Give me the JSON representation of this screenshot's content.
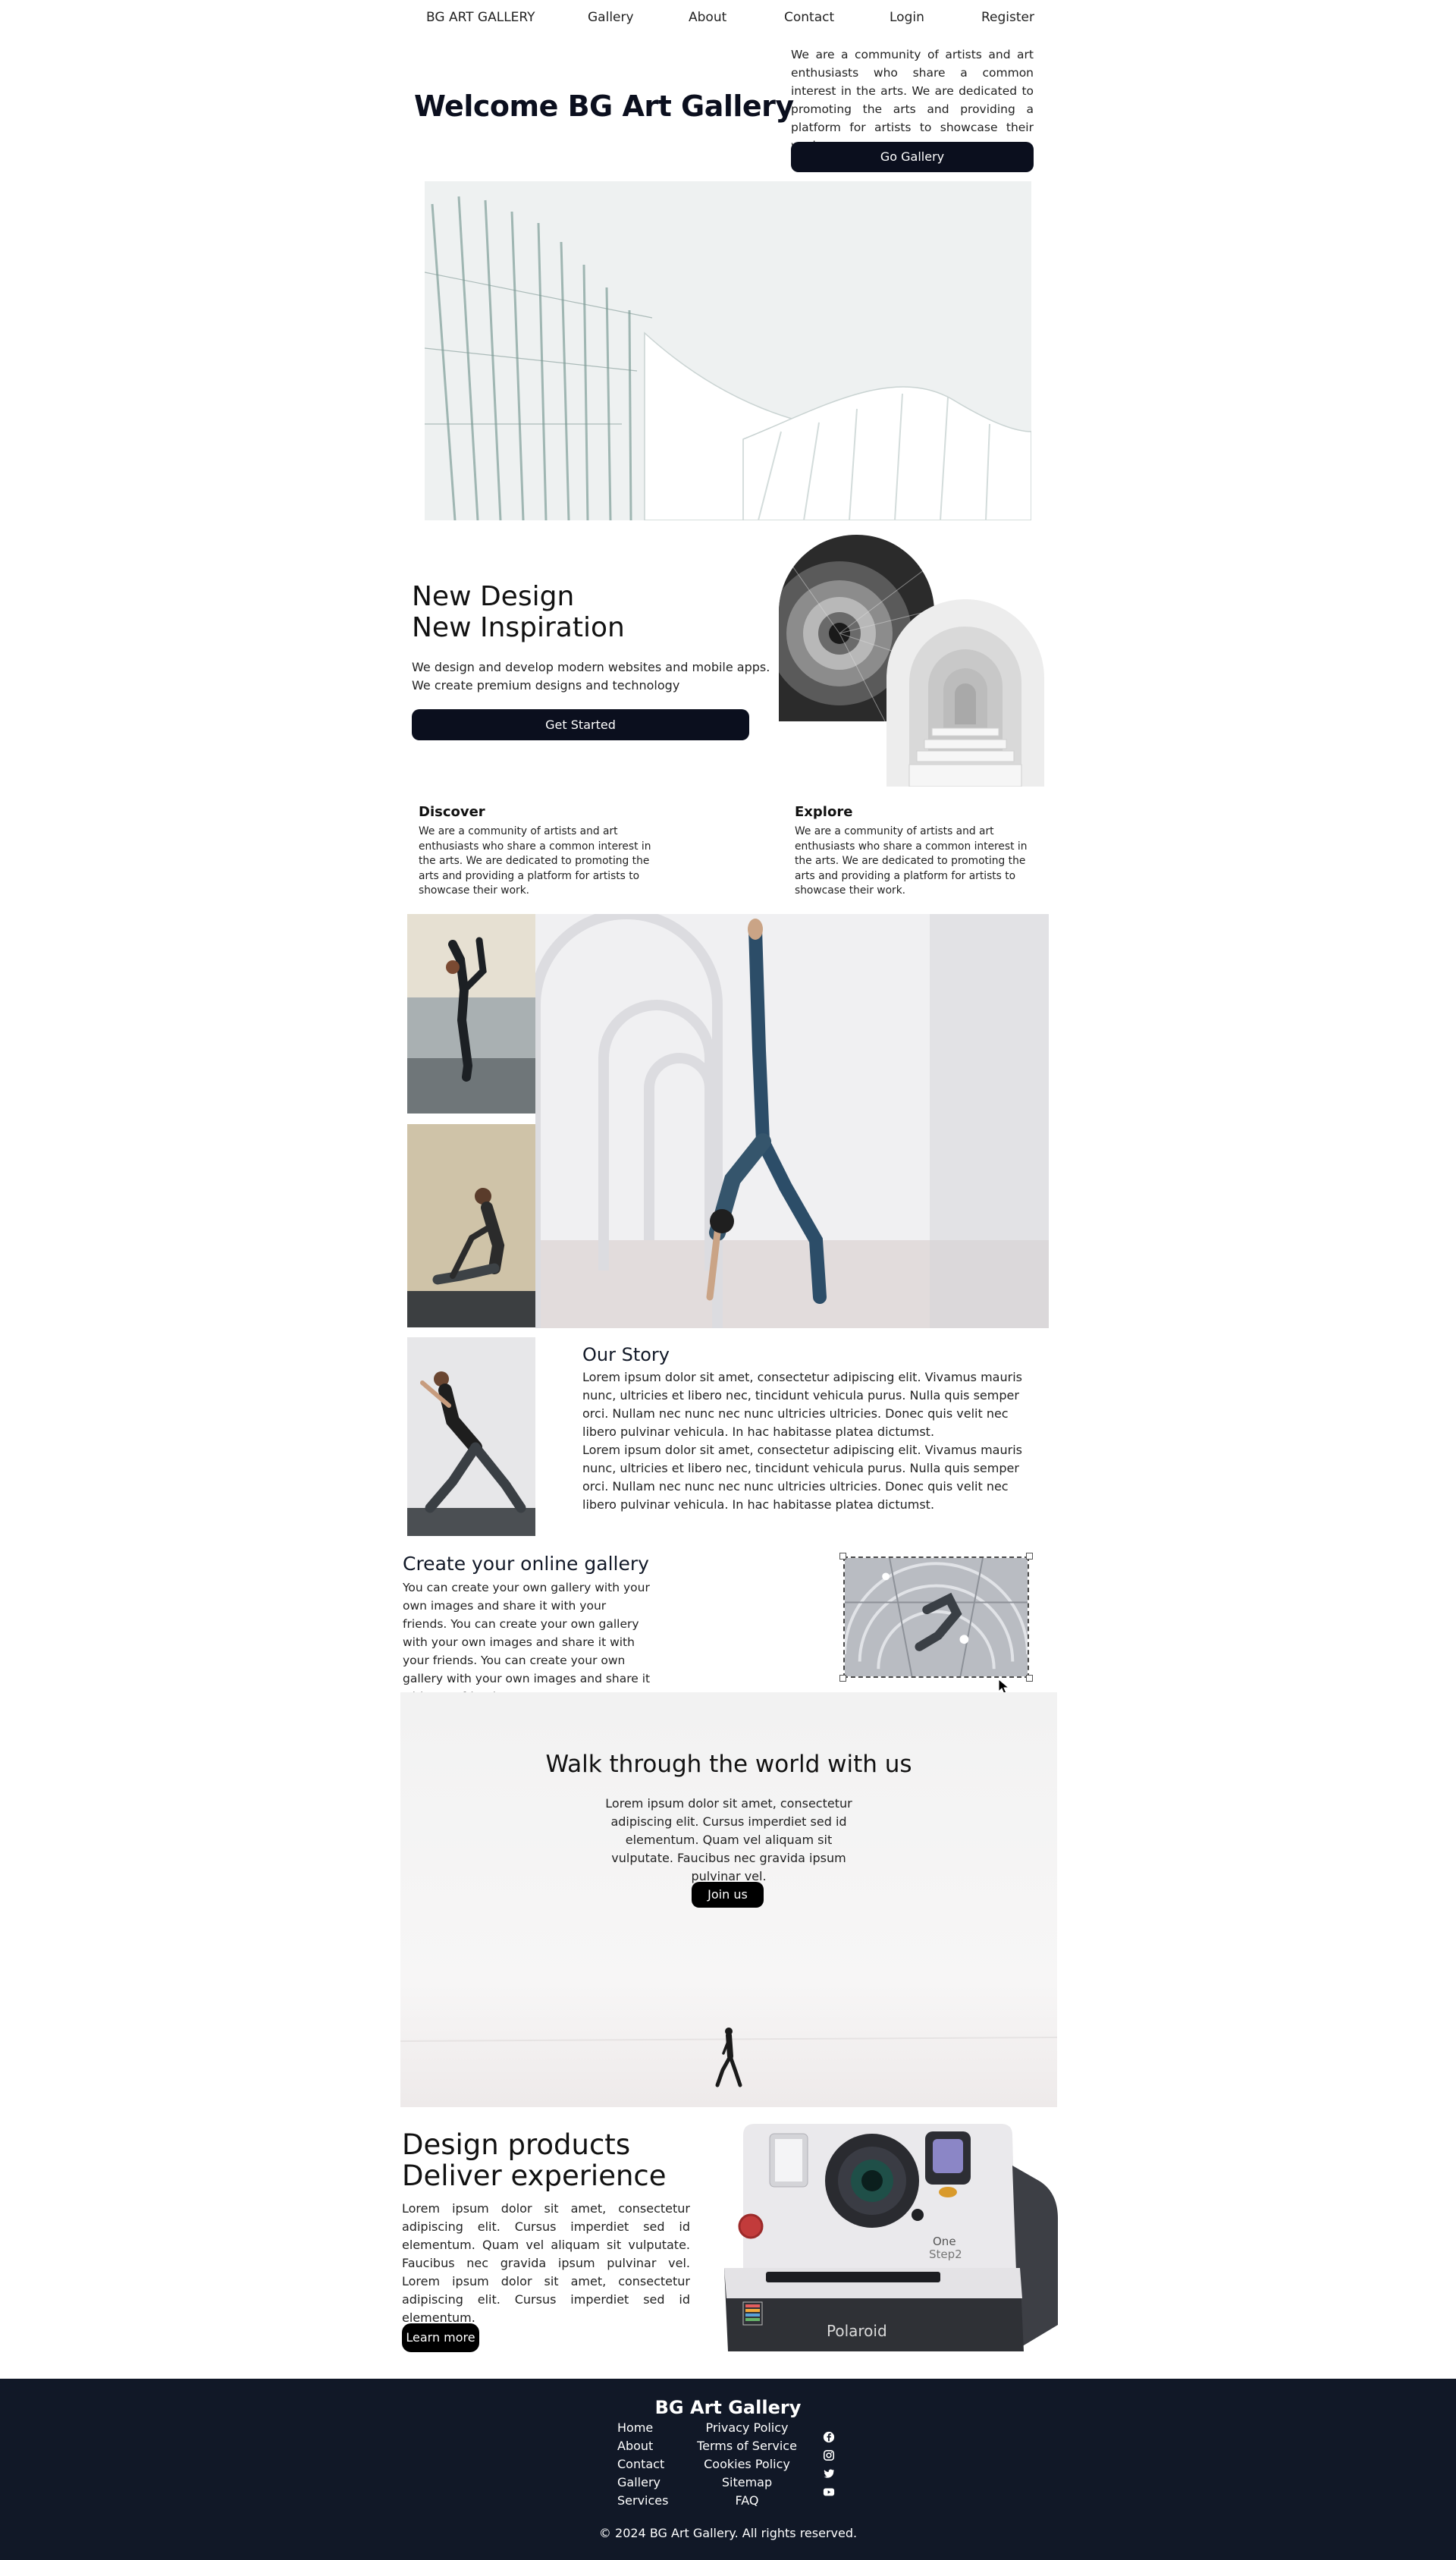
{
  "nav": {
    "brand": "BG ART GALLERY",
    "links": [
      "Gallery",
      "About",
      "Contact",
      "Login",
      "Register"
    ]
  },
  "hero": {
    "title": "Welcome BG Art Gallery",
    "description": "We are a community of artists and art enthusiasts who share a common interest in the arts. We are dedicated to promoting the arts and providing a platform for artists to showcase their work.",
    "button": "Go Gallery"
  },
  "new_design": {
    "title_line1": "New Design",
    "title_line2": "New Inspiration",
    "text_line1": "We design and develop modern websites and mobile apps.",
    "text_line2": "We create premium designs and technology",
    "button": "Get Started"
  },
  "features": [
    {
      "title": "Discover",
      "text": "We are a community of artists and art enthusiasts who share a common interest in the arts. We are dedicated to promoting the arts and providing a platform for artists to showcase their work."
    },
    {
      "title": "Explore",
      "text": "We are a community of artists and art enthusiasts who share a common interest in the arts. We are dedicated to promoting the arts and providing a platform for artists to showcase their work."
    }
  ],
  "story": {
    "title": "Our Story",
    "paragraph1": "Lorem ipsum dolor sit amet, consectetur adipiscing elit. Vivamus mauris nunc, ultricies et libero nec, tincidunt vehicula purus. Nulla quis semper orci. Nullam nec nunc nec nunc ultricies ultricies. Donec quis velit nec libero pulvinar vehicula. In hac habitasse platea dictumst.",
    "paragraph2": "Lorem ipsum dolor sit amet, consectetur adipiscing elit. Vivamus mauris nunc, ultricies et libero nec, tincidunt vehicula purus. Nulla quis semper orci. Nullam nec nunc nec nunc ultricies ultricies. Donec quis velit nec libero pulvinar vehicula. In hac habitasse platea dictumst."
  },
  "create": {
    "title": "Create your online gallery",
    "text": "You can create your own gallery with your own images and share it with your friends. You can create your own gallery with your own images and share it with your friends. You can create your own gallery with your own images and share it with your friends."
  },
  "walk": {
    "title": "Walk through the world with us",
    "text": "Lorem ipsum dolor sit amet, consectetur adipiscing elit. Cursus imperdiet sed id elementum. Quam vel aliquam sit vulputate. Faucibus nec gravida ipsum pulvinar vel.",
    "button": "Join us"
  },
  "products": {
    "title_line1": "Design products",
    "title_line2": "Deliver experience",
    "text": "Lorem ipsum dolor sit amet, consectetur adipiscing elit. Cursus imperdiet sed id elementum. Quam vel aliquam sit vulputate. Faucibus nec gravida ipsum pulvinar vel. Lorem ipsum dolor sit amet, consectetur adipiscing elit. Cursus imperdiet sed id elementum.",
    "button": "Learn more",
    "camera_brand": "Polaroid",
    "camera_model_line1": "One",
    "camera_model_line2": "Step2"
  },
  "footer": {
    "brand": "BG Art Gallery",
    "col1": [
      "Home",
      "About",
      "Contact",
      "Gallery",
      "Services"
    ],
    "col2": [
      "Privacy Policy",
      "Terms of Service",
      "Cookies Policy",
      "Sitemap",
      "FAQ"
    ],
    "social_icons": [
      "facebook-icon",
      "instagram-icon",
      "twitter-icon",
      "youtube-icon"
    ],
    "copyright": "© 2024 BG Art Gallery. All rights reserved."
  }
}
